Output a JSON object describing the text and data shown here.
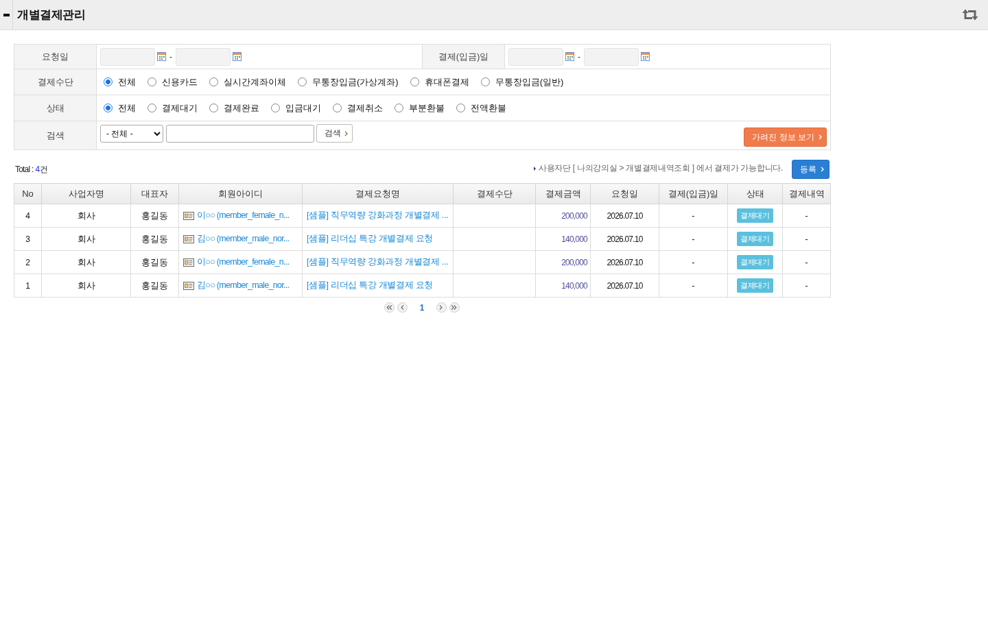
{
  "header": {
    "title": "개별결제관리"
  },
  "filters": {
    "request_date": {
      "label": "요청일",
      "separator": "-"
    },
    "paid_date": {
      "label": "결제(입금)일",
      "separator": "-"
    },
    "payment_method": {
      "label": "결제수단",
      "options": [
        {
          "label": "전체",
          "selected": true
        },
        {
          "label": "신용카드",
          "selected": false
        },
        {
          "label": "실시간계좌이체",
          "selected": false
        },
        {
          "label": "무통장입금(가상계좌)",
          "selected": false
        },
        {
          "label": "휴대폰결제",
          "selected": false
        },
        {
          "label": "무통장입금(일반)",
          "selected": false
        }
      ]
    },
    "status": {
      "label": "상태",
      "options": [
        {
          "label": "전체",
          "selected": true
        },
        {
          "label": "결제대기",
          "selected": false
        },
        {
          "label": "결제완료",
          "selected": false
        },
        {
          "label": "입금대기",
          "selected": false
        },
        {
          "label": "결제취소",
          "selected": false
        },
        {
          "label": "부분환불",
          "selected": false
        },
        {
          "label": "전액환불",
          "selected": false
        }
      ]
    },
    "search": {
      "label": "검색",
      "scope": "- 전체 -",
      "button": "검색",
      "hidden_info_button": "가려진 정보 보기"
    }
  },
  "summary": {
    "total_label": "Total :",
    "total_count": "4",
    "total_unit": "건",
    "notice": "사용자단 [ 나의강의실 > 개별결제내역조회 ] 에서 결제가 가능합니다.",
    "register_button": "등록"
  },
  "table": {
    "columns": [
      "No",
      "사업자명",
      "대표자",
      "회원아이디",
      "결제요청명",
      "결제수단",
      "결제금액",
      "요청일",
      "결제(입금)일",
      "상태",
      "결제내역"
    ],
    "rows": [
      {
        "no": "4",
        "company": "회사",
        "representative": "홍길동",
        "member": "이○○ (member_female_n...",
        "request_name": "[샘플] 직무역량 강화과정 개별결제 ...",
        "amount": "200,000",
        "request_date": "2026.07.10",
        "paid_date": "-",
        "status": "결제대기",
        "history": "-"
      },
      {
        "no": "3",
        "company": "회사",
        "representative": "홍길동",
        "member": "김○○ (member_male_nor...",
        "request_name": "[샘플] 리더십 특강 개별결제 요청",
        "amount": "140,000",
        "request_date": "2026.07.10",
        "paid_date": "-",
        "status": "결제대기",
        "history": "-"
      },
      {
        "no": "2",
        "company": "회사",
        "representative": "홍길동",
        "member": "이○○ (member_female_n...",
        "request_name": "[샘플] 직무역량 강화과정 개별결제 ...",
        "amount": "200,000",
        "request_date": "2026.07.10",
        "paid_date": "-",
        "status": "결제대기",
        "history": "-"
      },
      {
        "no": "1",
        "company": "회사",
        "representative": "홍길동",
        "member": "김○○ (member_male_nor...",
        "request_name": "[샘플] 리더십 특강 개별결제 요청",
        "amount": "140,000",
        "request_date": "2026.07.10",
        "paid_date": "-",
        "status": "결제대기",
        "history": "-"
      }
    ]
  },
  "pagination": {
    "pages": [
      {
        "label": "1",
        "selected": true
      }
    ]
  }
}
